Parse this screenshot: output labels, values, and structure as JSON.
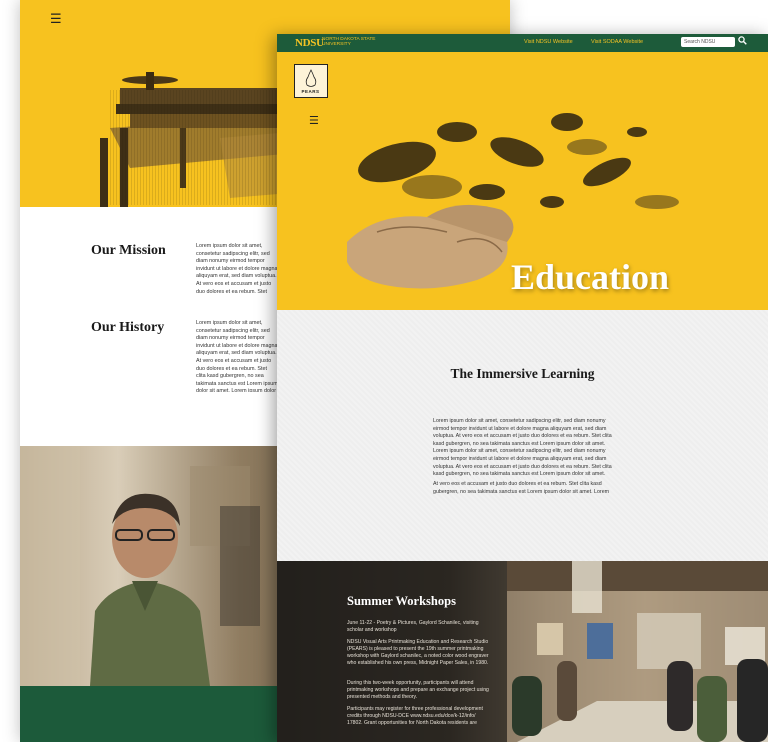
{
  "back_page": {
    "menu_icon": "hamburger-menu-icon",
    "mission_title": "Our Mission",
    "mission_text": "Lorem ipsum dolor sit amet, consetetur sadipscing elitr, sed diam nonumy eirmod tempor invidunt ut labore et dolore magna aliquyam erat, sed diam voluptua. At vero eos et accusam et justo duo dolores et ea rebum. Stet clita kasd gubergren, no sea takimata sanctus est Lorem ipsum dolor sit amet. Lorem ipsum dolor sit amet, consetetur sadipscing elitr, sed diam nonumy eirmod tempor invidunt ut labore et dolore magna aliquyam erat, sed diam voluptua. At vero eos. Stet clita kasd gubergren.",
    "history_title": "Our History",
    "history_text": "Lorem ipsum dolor sit amet, consetetur sadipscing elitr, sed diam nonumy eirmod tempor invidunt ut labore et dolore magna aliquyam erat, sed diam voluptua. At vero eos et accusam et justo duo dolores et ea rebum. Stet clita kasd gubergren, no sea takimata sanctus est Lorem ipsum dolor sit amet. Lorem ipsum dolor sit amet, consetetur sadipscing elitr, sed diam nonumy eirmod tempor invidunt ut labore et dolore magna aliquyam erat, sed diam voluptua. At vero eos et accusam et justo duo dolores et ea rebum. Stet clita kasd gubergren, no sea takimata sanctus est Lorem ipsum dolor sit amet. Lorem ipsum dolor sit amet, consetetur sadipscing elitr, sed diam nonumy eirmod tempor invidunt ut labore et dolore magna aliquyam erat, sed diam voluptua. At vero eos et accusam et justo duo dolores et ea rebum. Stet clita kasd gubergren."
  },
  "front_page": {
    "topbar": {
      "logo": "NDSU",
      "logo_sub": "NORTH DAKOTA STATE UNIVERSITY",
      "link_ndsu": "Visit NDSU Website",
      "link_sodaa": "Visit SODAA Website",
      "search_placeholder": "Search NDSU",
      "search_icon": "search-icon"
    },
    "pears_logo": "PEARS",
    "hero_title": "Education",
    "learning": {
      "title": "The Immersive Learning",
      "para1": "Lorem ipsum dolor sit amet, consetetur sadipscing elitr, sed diam nonumy eirmod tempor invidunt ut labore et dolore magna aliquyam erat, sed diam voluptua. At vero eos et accusam et justo duo dolores et ea rebum. Stet clita kasd gubergren, no sea takimata sanctus est Lorem ipsum dolor sit amet. Lorem ipsum dolor sit amet, consetetur sadipscing elitr, sed diam nonumy eirmod tempor invidunt ut labore et dolore magna aliquyam erat, sed diam voluptua. At vero eos et accusam et justo duo dolores et ea rebum. Stet clita kasd gubergren, no sea takimata sanctus est Lorem ipsum dolor sit amet.",
      "para2": "At vero eos et accusam et justo duo dolores et ea rebum. Stet clita kasd gubergren, no sea takimata sanctus est Lorem ipsum dolor sit amet. Lorem"
    },
    "workshops": {
      "title": "Summer Workshops",
      "p1": "June 11-22 - Poetry & Pictures, Gaylord Schanilec, visiting scholar and workshop",
      "p2": "NDSU Visual Arts Printmaking Education and Research Studio (PEARS) is pleased to present the 19th summer printmaking workshop with Gaylord schanilec, a noted color wood engraver who established his own press, Midnight Paper Sales, in 1980.",
      "p3": "During this two-week opportunity, participants will attend printmaking workshops and prepare an exchange project using presented methods and theory.",
      "p4": "Participants may register for three professional development credits through NDSU-DCE www.ndsu.edu/dce/k-12/info/ 17802. Grant opportunities for North Dakota residents are"
    }
  },
  "colors": {
    "yellow": "#f7c21f",
    "green": "#1d5b3a",
    "gold_text": "#f5c323"
  }
}
